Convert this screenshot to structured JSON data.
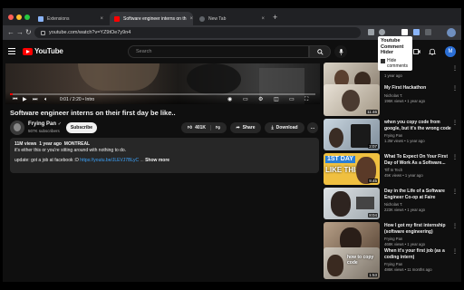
{
  "browser": {
    "tabs": [
      {
        "label": "Extensions",
        "close": "×"
      },
      {
        "label": "Software engineer interns on th",
        "close": "×"
      },
      {
        "label": "New Tab",
        "close": "×"
      }
    ],
    "new_tab": "+",
    "url": "youtube.com/watch?v=YZ9tOe7y9n4"
  },
  "youtube": {
    "logo_text": "YouTube",
    "search_placeholder": "Search",
    "avatar_letter": "M"
  },
  "tooltip": {
    "title": "Youtube Comment Hider",
    "sub": "Hide comments"
  },
  "player": {
    "time": "0:01 / 2:20",
    "chapter": "Intro",
    "progress": 0.01
  },
  "video": {
    "title": "Software engineer interns on their first day be like..",
    "channel": "Frying Pan",
    "subs": "507K subscribers",
    "subscribe": "Subscribe",
    "likes": "401K",
    "share": "Share",
    "download": "Download",
    "more": "…"
  },
  "description": {
    "meta_views": "11M views",
    "meta_age": "1 year ago",
    "meta_loc": "MONTREAL",
    "line1": "it's either this or you're sitting around with nothing to do.",
    "line2_prefix": "update: got a job at facebook :D",
    "link": "https://youtu.be/JLEVJ7BLyC",
    "show_more": "Show more"
  },
  "sidebar": [
    {
      "title": "",
      "channel": "",
      "meta": "1 year ago",
      "duration": "4:48"
    },
    {
      "title": "My First Hackathon",
      "channel": "Nicholas T.",
      "meta": "196K views • 1 year ago",
      "duration": "11:46"
    },
    {
      "title": "when you copy code from google, but it's the wrong code",
      "channel": "Frying Pan",
      "meta": "1.3M views • 1 year ago",
      "duration": "2:07"
    },
    {
      "title": "What To Expect On Your First Day of Work As a Software...",
      "channel": "Tiff In Tech",
      "meta": "45K views • 1 year ago",
      "duration": "9:45"
    },
    {
      "title": "Day in the Life of a Software Engineer Co-op at Faire",
      "channel": "Nicholas T.",
      "meta": "223K views • 1 year ago",
      "duration": "8:04"
    },
    {
      "title": "How I got my first internship (software engineering)",
      "channel": "Frying Pan",
      "meta": "468K views • 1 year ago",
      "duration": "5:41"
    },
    {
      "title": "When it's your first job (as a coding intern)",
      "channel": "Frying Pan",
      "meta": "486K views • 11 months ago",
      "duration": "1:53"
    }
  ],
  "thumb_text": {
    "first_day": "1ST DAY",
    "like_this": "LIKE THIS",
    "copy_code": "how to copy code"
  }
}
